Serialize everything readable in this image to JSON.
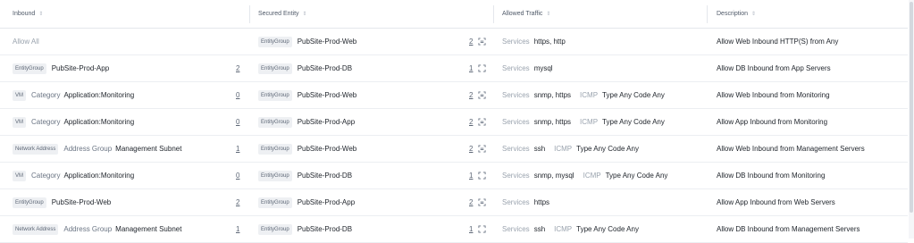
{
  "header": {
    "inbound": "Inbound",
    "secured_entity": "Secured Entity",
    "allowed_traffic": "Allowed Traffic",
    "description": "Description"
  },
  "rows": [
    {
      "inbound": {
        "tag": "",
        "label": "",
        "value": "",
        "count": ""
      },
      "allow_all": "Allow All",
      "secured": {
        "tag": "EntityGroup",
        "value": "PubSite-Prod-Web",
        "count": "2",
        "icon": "shield-expand-icon"
      },
      "traffic": {
        "svc_label": "Services",
        "svc_value": "https, http",
        "icmp_label": "",
        "icmp_value": ""
      },
      "description": "Allow Web Inbound HTTP(S) from Any"
    },
    {
      "inbound": {
        "tag": "EntityGroup",
        "label": "",
        "value": "PubSite-Prod-App",
        "count": "2"
      },
      "allow_all": "",
      "secured": {
        "tag": "EntityGroup",
        "value": "PubSite-Prod-DB",
        "count": "1",
        "icon": "expand-arrows-icon"
      },
      "traffic": {
        "svc_label": "Services",
        "svc_value": "mysql",
        "icmp_label": "",
        "icmp_value": ""
      },
      "description": "Allow DB Inbound from App Servers"
    },
    {
      "inbound": {
        "tag": "VM",
        "label": "Category",
        "value": "Application:Monitoring",
        "count": "0"
      },
      "allow_all": "",
      "secured": {
        "tag": "EntityGroup",
        "value": "PubSite-Prod-Web",
        "count": "2",
        "icon": "shield-expand-icon"
      },
      "traffic": {
        "svc_label": "Services",
        "svc_value": "snmp, https",
        "icmp_label": "ICMP",
        "icmp_value": "Type Any Code Any"
      },
      "description": "Allow Web Inbound from Monitoring"
    },
    {
      "inbound": {
        "tag": "VM",
        "label": "Category",
        "value": "Application:Monitoring",
        "count": "0"
      },
      "allow_all": "",
      "secured": {
        "tag": "EntityGroup",
        "value": "PubSite-Prod-App",
        "count": "2",
        "icon": "shield-expand-icon"
      },
      "traffic": {
        "svc_label": "Services",
        "svc_value": "snmp, https",
        "icmp_label": "ICMP",
        "icmp_value": "Type Any Code Any"
      },
      "description": "Allow App Inbound from Monitoring"
    },
    {
      "inbound": {
        "tag": "Network Address",
        "label": "Address Group",
        "value": "Management Subnet",
        "count": "1"
      },
      "allow_all": "",
      "secured": {
        "tag": "EntityGroup",
        "value": "PubSite-Prod-Web",
        "count": "2",
        "icon": "shield-expand-icon"
      },
      "traffic": {
        "svc_label": "Services",
        "svc_value": "ssh",
        "icmp_label": "ICMP",
        "icmp_value": "Type Any Code Any"
      },
      "description": "Allow Web Inbound from Management Servers"
    },
    {
      "inbound": {
        "tag": "VM",
        "label": "Category",
        "value": "Application:Monitoring",
        "count": "0"
      },
      "allow_all": "",
      "secured": {
        "tag": "EntityGroup",
        "value": "PubSite-Prod-DB",
        "count": "1",
        "icon": "expand-arrows-icon"
      },
      "traffic": {
        "svc_label": "Services",
        "svc_value": "snmp, mysql",
        "icmp_label": "ICMP",
        "icmp_value": "Type Any Code Any"
      },
      "description": "Allow DB Inbound from Monitoring"
    },
    {
      "inbound": {
        "tag": "EntityGroup",
        "label": "",
        "value": "PubSite-Prod-Web",
        "count": "2"
      },
      "allow_all": "",
      "secured": {
        "tag": "EntityGroup",
        "value": "PubSite-Prod-App",
        "count": "2",
        "icon": "shield-expand-icon"
      },
      "traffic": {
        "svc_label": "Services",
        "svc_value": "https",
        "icmp_label": "",
        "icmp_value": ""
      },
      "description": "Allow App Inbound from Web Servers"
    },
    {
      "inbound": {
        "tag": "Network Address",
        "label": "Address Group",
        "value": "Management Subnet",
        "count": "1"
      },
      "allow_all": "",
      "secured": {
        "tag": "EntityGroup",
        "value": "PubSite-Prod-DB",
        "count": "1",
        "icon": "expand-arrows-icon"
      },
      "traffic": {
        "svc_label": "Services",
        "svc_value": "ssh",
        "icmp_label": "ICMP",
        "icmp_value": "Type Any Code Any"
      },
      "description": "Allow DB Inbound from Management Servers"
    }
  ]
}
